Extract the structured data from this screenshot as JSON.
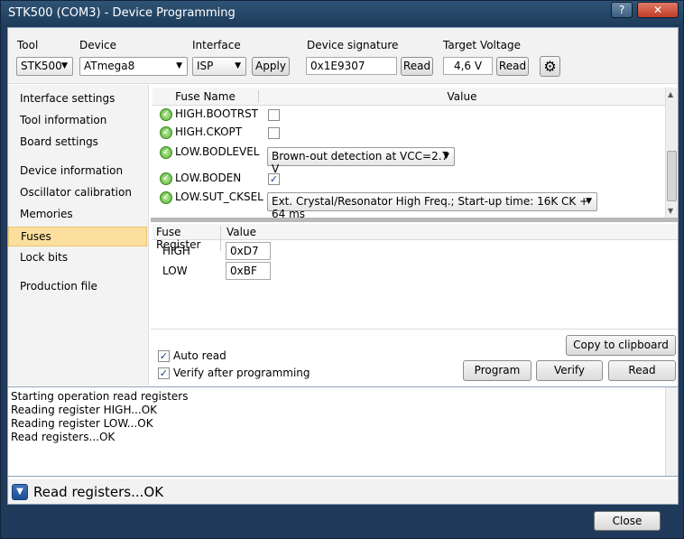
{
  "window": {
    "title": "STK500 (COM3) - Device Programming",
    "help_label": "?",
    "close_label": "✕"
  },
  "toolbar": {
    "tool_label": "Tool",
    "tool_value": "STK500",
    "device_label": "Device",
    "device_value": "ATmega8",
    "interface_label": "Interface",
    "interface_value": "ISP",
    "apply_label": "Apply",
    "signature_label": "Device signature",
    "signature_value": "0x1E9307",
    "signature_read_label": "Read",
    "voltage_label": "Target Voltage",
    "voltage_value": "4,6 V",
    "voltage_read_label": "Read",
    "settings_icon": "gear-icon"
  },
  "sidebar": {
    "items": [
      {
        "label": "Interface settings"
      },
      {
        "label": "Tool information"
      },
      {
        "label": "Board settings"
      },
      {
        "label": "Device information"
      },
      {
        "label": "Oscillator calibration"
      },
      {
        "label": "Memories"
      },
      {
        "label": "Fuses"
      },
      {
        "label": "Lock bits"
      },
      {
        "label": "Production file"
      }
    ],
    "active": "Fuses",
    "active_color": "#fcdf9c"
  },
  "fuses": {
    "col_name": "Fuse Name",
    "col_value": "Value",
    "rows": [
      {
        "name": "HIGH.BOOTRST",
        "type": "checkbox",
        "checked": false
      },
      {
        "name": "HIGH.CKOPT",
        "type": "checkbox",
        "checked": false
      },
      {
        "name": "LOW.BODLEVEL",
        "type": "select",
        "value": "Brown-out detection at VCC=2.7 V"
      },
      {
        "name": "LOW.BODEN",
        "type": "checkbox",
        "checked": true
      },
      {
        "name": "LOW.SUT_CKSEL",
        "type": "select",
        "value": "Ext. Crystal/Resonator High Freq.; Start-up time: 16K CK + 64 ms"
      }
    ]
  },
  "registers": {
    "col_register": "Fuse Register",
    "col_value": "Value",
    "rows": [
      {
        "name": "HIGH",
        "value": "0xD7"
      },
      {
        "name": "LOW",
        "value": "0xBF"
      }
    ]
  },
  "options": {
    "auto_read_label": "Auto read",
    "auto_read_checked": true,
    "verify_label": "Verify after programming",
    "verify_checked": true
  },
  "actions": {
    "copy_label": "Copy to clipboard",
    "program_label": "Program",
    "verify_label": "Verify",
    "read_label": "Read"
  },
  "log": {
    "lines": [
      "Starting operation read registers",
      "Reading register HIGH...OK",
      "Reading register LOW...OK",
      "Read registers...OK"
    ]
  },
  "status": {
    "text": "Read registers...OK"
  },
  "footer": {
    "close_label": "Close"
  }
}
